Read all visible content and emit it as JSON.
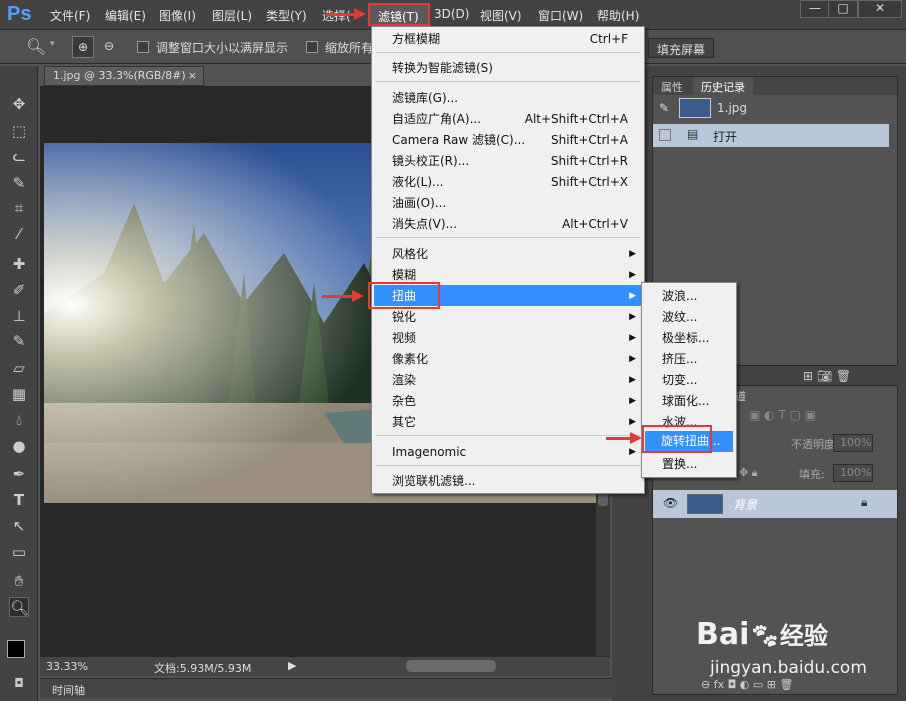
{
  "app": {
    "logo": "Ps",
    "menu": [
      "文件(F)",
      "编辑(E)",
      "图像(I)",
      "图层(L)",
      "类型(Y)",
      "选择(",
      "滤镜(T)",
      "3D(D)",
      "视图(V)",
      "窗口(W)",
      "帮助(H)"
    ],
    "window_buttons": [
      "—",
      "□",
      "✕"
    ]
  },
  "options_bar": {
    "resize_window_label": "调整窗口大小以满屏显示",
    "zoom_all_label": "缩放所有",
    "fill_screen_btn": "填充屏幕"
  },
  "document": {
    "tab_title": "1.jpg @ 33.3%(RGB/8#)",
    "tab_close": "×",
    "zoom": "33.33%",
    "doc_info": "文档:5.93M/5.93M",
    "timeline_label": "时间轴"
  },
  "filter_menu": {
    "items_top": [
      {
        "label": "方框模糊",
        "shortcut": "Ctrl+F"
      },
      {
        "label": "转换为智能滤镜(S)",
        "shortcut": ""
      }
    ],
    "items_mid": [
      {
        "label": "滤镜库(G)...",
        "shortcut": ""
      },
      {
        "label": "自适应广角(A)...",
        "shortcut": "Alt+Shift+Ctrl+A"
      },
      {
        "label": "Camera Raw 滤镜(C)...",
        "shortcut": "Shift+Ctrl+A"
      },
      {
        "label": "镜头校正(R)...",
        "shortcut": "Shift+Ctrl+R"
      },
      {
        "label": "液化(L)...",
        "shortcut": "Shift+Ctrl+X"
      },
      {
        "label": "油画(O)...",
        "shortcut": ""
      },
      {
        "label": "消失点(V)...",
        "shortcut": "Alt+Ctrl+V"
      }
    ],
    "items_sub": [
      "风格化",
      "模糊",
      "扭曲",
      "锐化",
      "视频",
      "像素化",
      "渲染",
      "杂色",
      "其它"
    ],
    "plugin": "Imagenomic",
    "browse": "浏览联机滤镜..."
  },
  "distort_submenu": [
    "波浪...",
    "波纹...",
    "极坐标...",
    "挤压...",
    "切变...",
    "球面化...",
    "水波...",
    "旋转扭曲...",
    "置换..."
  ],
  "history_panel": {
    "tabs": [
      "属性",
      "历史记录"
    ],
    "snapshot": "1.jpg",
    "entries": [
      "打开"
    ]
  },
  "layers_panel": {
    "tab_partial": "道",
    "opacity_label": "不透明度:",
    "opacity_value": "100%",
    "fill_label": "填充:",
    "fill_value": "100%",
    "layer_name": "背景"
  },
  "watermark": {
    "brand": "Bai",
    "brand2": "经验",
    "url": "jingyan.baidu.com"
  },
  "colors": {
    "accent": "#3390ff",
    "highlight_box": "#e53935"
  }
}
